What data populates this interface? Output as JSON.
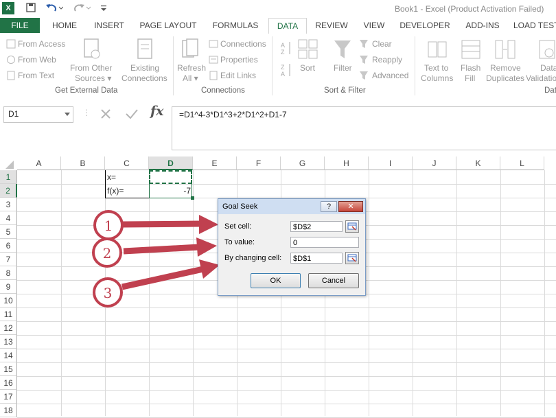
{
  "titlebar": {
    "app_icon": "X",
    "title": "Book1 - Excel (Product Activation Failed)"
  },
  "tabs": [
    "FILE",
    "HOME",
    "INSERT",
    "PAGE LAYOUT",
    "FORMULAS",
    "DATA",
    "REVIEW",
    "VIEW",
    "DEVELOPER",
    "ADD-INS",
    "LOAD TEST"
  ],
  "active_tab": "DATA",
  "ribbon": {
    "get_external": {
      "from_access": "From Access",
      "from_web": "From Web",
      "from_text": "From Text",
      "from_other_1": "From Other",
      "from_other_2": "Sources ▾",
      "existing_1": "Existing",
      "existing_2": "Connections",
      "label": "Get External Data"
    },
    "connections": {
      "refresh_1": "Refresh",
      "refresh_2": "All ▾",
      "connections": "Connections",
      "properties": "Properties",
      "edit_links": "Edit Links",
      "label": "Connections"
    },
    "sort_filter": {
      "sort": "Sort",
      "filter": "Filter",
      "clear": "Clear",
      "reapply": "Reapply",
      "advanced": "Advanced",
      "label": "Sort & Filter"
    },
    "data_tools": {
      "text_to_1": "Text to",
      "text_to_2": "Columns",
      "flash_1": "Flash",
      "flash_2": "Fill",
      "remove_1": "Remove",
      "remove_2": "Duplicates",
      "valid_1": "Data",
      "valid_2": "Validation",
      "label": "Dat"
    }
  },
  "formula_bar": {
    "name_box": "D1",
    "fx": "fx",
    "formula": "=D1^4-3*D1^3+2*D1^2+D1-7"
  },
  "grid": {
    "columns": [
      "A",
      "B",
      "C",
      "D",
      "E",
      "F",
      "G",
      "H",
      "I",
      "J",
      "K",
      "L"
    ],
    "rows": [
      "1",
      "2",
      "3",
      "4",
      "5",
      "6",
      "7",
      "8",
      "9",
      "10",
      "11",
      "12",
      "13",
      "14",
      "15",
      "16",
      "17",
      "18"
    ],
    "cells": {
      "C1": "x=",
      "C2": "f(x)=",
      "D2": "-7"
    }
  },
  "dialog": {
    "title": "Goal Seek",
    "help": "?",
    "close": "✕",
    "set_cell_label": "Set cell:",
    "set_cell_value": "$D$2",
    "to_value_label": "To value:",
    "to_value_value": "0",
    "changing_label": "By changing cell:",
    "changing_value": "$D$1",
    "ok": "OK",
    "cancel": "Cancel"
  },
  "annotations": {
    "markers": [
      "1",
      "2",
      "3"
    ],
    "color": "#c0404f"
  }
}
